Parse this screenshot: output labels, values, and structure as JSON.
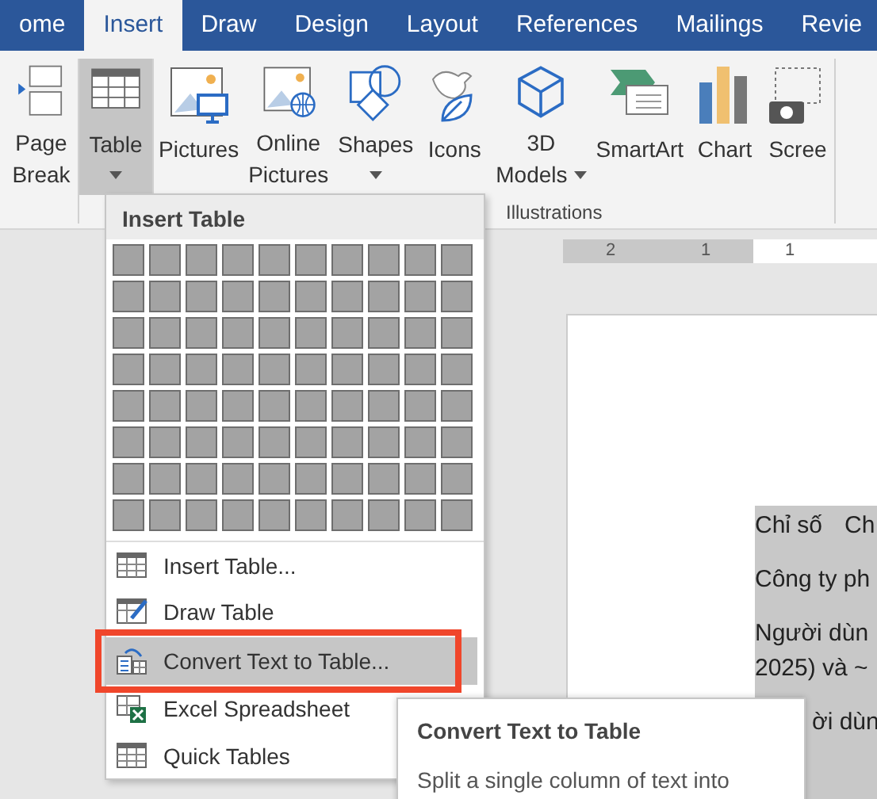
{
  "tabs": [
    {
      "label": "ome",
      "selected": false
    },
    {
      "label": "Insert",
      "selected": true
    },
    {
      "label": "Draw",
      "selected": false
    },
    {
      "label": "Design",
      "selected": false
    },
    {
      "label": "Layout",
      "selected": false
    },
    {
      "label": "References",
      "selected": false
    },
    {
      "label": "Mailings",
      "selected": false
    },
    {
      "label": "Revie",
      "selected": false
    }
  ],
  "ribbon": {
    "groups": [
      {
        "buttons": [
          {
            "kind": "page-break",
            "lines": [
              "Page",
              "Break"
            ],
            "caret": false,
            "selected": false
          }
        ]
      },
      {
        "buttons": [
          {
            "kind": "table",
            "lines": [
              "Table"
            ],
            "caret": true,
            "selected": true
          }
        ]
      },
      {
        "label": "Illustrations",
        "buttons": [
          {
            "kind": "pictures",
            "lines": [
              "Pictures"
            ],
            "caret": false,
            "selected": false
          },
          {
            "kind": "online-pictures",
            "lines": [
              "Online",
              "Pictures"
            ],
            "caret": false,
            "selected": false
          },
          {
            "kind": "shapes",
            "lines": [
              "Shapes"
            ],
            "caret": true,
            "selected": false
          },
          {
            "kind": "icons",
            "lines": [
              "Icons"
            ],
            "caret": false,
            "selected": false
          },
          {
            "kind": "models",
            "lines": [
              "3D",
              "Models"
            ],
            "caret": true,
            "selected": false
          },
          {
            "kind": "smartart",
            "lines": [
              "SmartArt"
            ],
            "caret": false,
            "selected": false
          },
          {
            "kind": "chart",
            "lines": [
              "Chart"
            ],
            "caret": false,
            "selected": false
          },
          {
            "kind": "screenshot",
            "lines": [
              "Scree"
            ],
            "caret": false,
            "selected": false
          }
        ]
      }
    ]
  },
  "ruler": {
    "labels": [
      "2",
      "1",
      "1"
    ]
  },
  "document": {
    "paragraphs": [
      {
        "kind": "plain",
        "lines": [
          [
            "Chỉ số",
            "Ch"
          ]
        ]
      },
      {
        "kind": "plain",
        "lines": [
          [
            "Công ty ph"
          ]
        ]
      },
      {
        "kind": "plain",
        "lines": [
          [
            "Người dùn"
          ],
          [
            "2025) và ~"
          ]
        ]
      },
      {
        "kind": "covered",
        "lines": [
          [
            "ời dùn"
          ]
        ]
      }
    ]
  },
  "menu": {
    "title": "Insert Table",
    "items": [
      {
        "kind": "insert",
        "label": "Insert Table...",
        "selected": false
      },
      {
        "kind": "draw",
        "label": "Draw Table",
        "selected": false
      },
      {
        "kind": "convert",
        "label": "Convert Text to Table...",
        "selected": true
      },
      {
        "kind": "excel",
        "label": "Excel Spreadsheet",
        "selected": false
      },
      {
        "kind": "quick",
        "label": "Quick Tables",
        "selected": false
      }
    ]
  },
  "tooltip": {
    "title": "Convert Text to Table",
    "text": "Split a single column of text into"
  }
}
